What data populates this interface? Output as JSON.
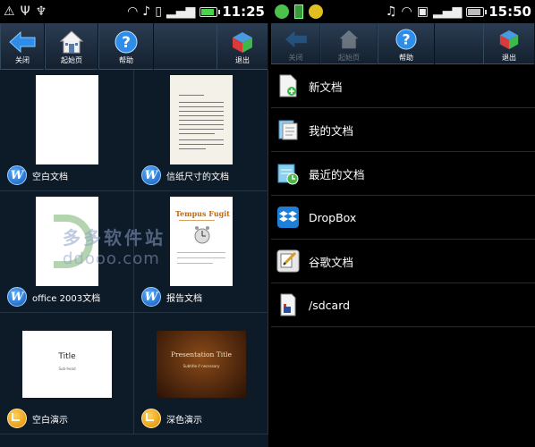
{
  "left": {
    "status": {
      "time": "11:25"
    },
    "toolbar": {
      "close": "关闭",
      "home": "起始页",
      "help": "帮助",
      "exit": "退出"
    },
    "cells": [
      {
        "label": "空白文档",
        "icon": "word-w-icon"
      },
      {
        "label": "信纸尺寸的文档",
        "icon": "word-w-icon"
      },
      {
        "label": "office 2003文档",
        "icon": "word-w-icon"
      },
      {
        "label": "报告文档",
        "icon": "word-w-icon"
      },
      {
        "label": "空白演示",
        "icon": "presentation-icon"
      },
      {
        "label": "深色演示",
        "icon": "presentation-icon"
      }
    ],
    "report_thumb": {
      "title": "Tempus Fugit"
    },
    "blank_pres_thumb": {
      "title": "Title",
      "subtitle": "Sub-head"
    },
    "dark_pres_thumb": {
      "title": "Presentation Title",
      "subtitle": "Subtitle if necessary"
    }
  },
  "right": {
    "status": {
      "time": "15:50"
    },
    "toolbar": {
      "close": "关闭",
      "home": "起始页",
      "help": "帮助",
      "exit": "退出"
    },
    "items": [
      {
        "label": "新文档",
        "icon": "new-document-icon"
      },
      {
        "label": "我的文档",
        "icon": "my-documents-icon"
      },
      {
        "label": "最近的文档",
        "icon": "recent-documents-icon"
      },
      {
        "label": "DropBox",
        "icon": "dropbox-icon"
      },
      {
        "label": "谷歌文档",
        "icon": "google-docs-icon"
      },
      {
        "label": "/sdcard",
        "icon": "sdcard-icon"
      }
    ]
  },
  "watermark": {
    "line1": "多多软件站",
    "line2": "ddooo.com"
  },
  "colors": {
    "accent": "#3aa0ff",
    "background_left": "#0d1a28",
    "background_right": "#000000"
  }
}
